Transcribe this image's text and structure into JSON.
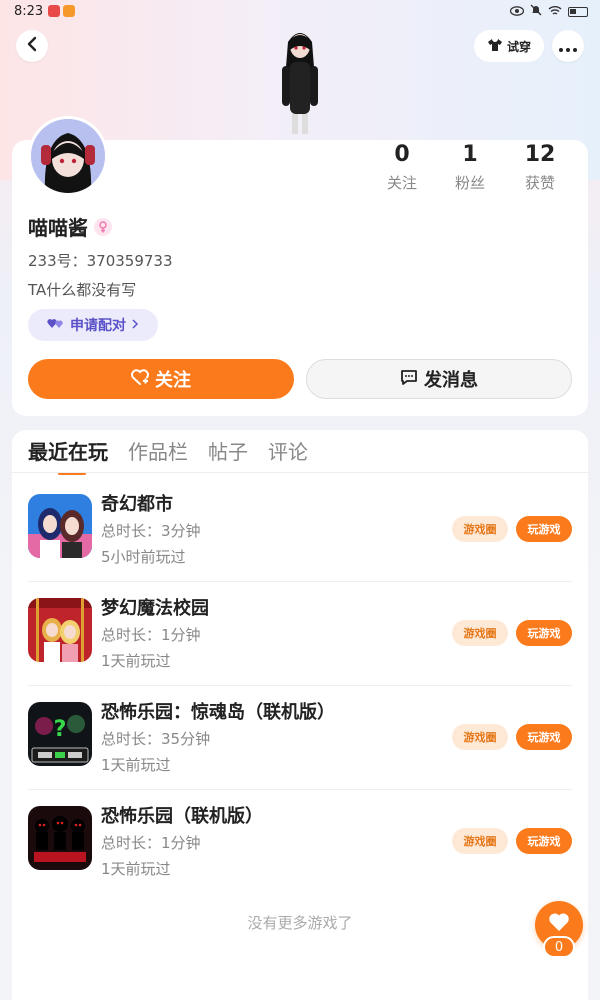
{
  "status_bar": {
    "time": "8:23"
  },
  "header": {
    "back_icon": "chevron-left-icon",
    "tryon_label": "试穿",
    "more_icon": "more-dots-icon"
  },
  "profile": {
    "following_count": "0",
    "following_label": "关注",
    "fans_count": "1",
    "fans_label": "粉丝",
    "likes_count": "12",
    "likes_label": "获赞",
    "username": "喵喵酱",
    "uid": "233号：370359733",
    "bio": "TA什么都没有写",
    "pair_label": "申请配对",
    "follow_label": "关注",
    "message_label": "发消息"
  },
  "tabs": [
    {
      "label": "最近在玩"
    },
    {
      "label": "作品栏"
    },
    {
      "label": "帖子"
    },
    {
      "label": "评论"
    }
  ],
  "games": [
    {
      "title": "奇幻都市",
      "duration": "总时长：3分钟",
      "last_played": "5小时前玩过",
      "circle_label": "游戏圈",
      "play_label": "玩游戏"
    },
    {
      "title": "梦幻魔法校园",
      "duration": "总时长：1分钟",
      "last_played": "1天前玩过",
      "circle_label": "游戏圈",
      "play_label": "玩游戏"
    },
    {
      "title": "恐怖乐园：惊魂岛（联机版）",
      "duration": "总时长：35分钟",
      "last_played": "1天前玩过",
      "circle_label": "游戏圈",
      "play_label": "玩游戏"
    },
    {
      "title": "恐怖乐园（联机版）",
      "duration": "总时长：1分钟",
      "last_played": "1天前玩过",
      "circle_label": "游戏圈",
      "play_label": "玩游戏"
    }
  ],
  "footer": {
    "no_more": "没有更多游戏了",
    "like_count": "0"
  },
  "colors": {
    "accent": "#fb7a1b",
    "pair_bg": "#ecebfb",
    "pair_text": "#5b52c8"
  }
}
